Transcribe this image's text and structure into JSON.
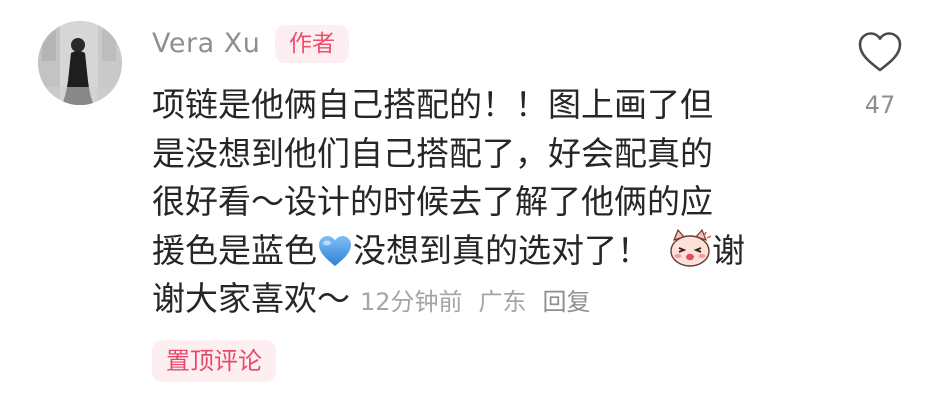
{
  "comment": {
    "author": "Vera Xu",
    "author_badge": "作者",
    "lines": [
      "项链是他俩自己搭配的！！图上画了但",
      "是没想到他们自己搭配了，好会配真的",
      "很好看～设计的时候去了解了他俩的应",
      "援色是蓝色",
      "没想到真的选对了！",
      "谢",
      "谢大家喜欢～"
    ],
    "timestamp": "12分钟前",
    "location": "广东",
    "reply_label": "回复",
    "like_count": "47",
    "pinned_label": "置顶评论"
  },
  "icons": {
    "emoji_1": "blue-heart-icon",
    "emoji_2": "blushing-cat-sticker-icon",
    "like": "heart-outline-icon"
  },
  "colors": {
    "accent": "#ef4f6b",
    "badge_bg": "#fdeff1",
    "text": "#262626",
    "meta": "#a5a5a5",
    "blue_heart": "#4a90e2"
  }
}
